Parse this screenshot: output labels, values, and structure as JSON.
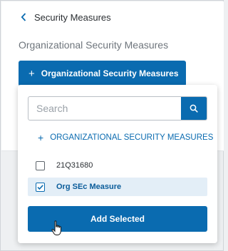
{
  "header": {
    "back_label": "Security Measures",
    "section_label": "Organizational Security Measures",
    "add_button_label": "Organizational Security Measures"
  },
  "dropdown": {
    "search_placeholder": "Search",
    "add_new_label": "ORGANIZATIONAL SECURITY MEASURES",
    "items": [
      {
        "label": "21Q31680",
        "checked": false
      },
      {
        "label": "Org SEc Measure",
        "checked": true
      }
    ],
    "add_selected_label": "Add Selected"
  },
  "icons": {
    "back": "chevron-left-icon",
    "add": "plus-icon",
    "search": "search-icon",
    "checkbox": "checkbox-icon",
    "cursor": "hand-pointer-icon"
  },
  "colors": {
    "primary": "#0a6bb0",
    "selected_row_bg": "#e3eef7",
    "selected_text": "#0a5c9a",
    "page_bg": "#eef0f2"
  }
}
